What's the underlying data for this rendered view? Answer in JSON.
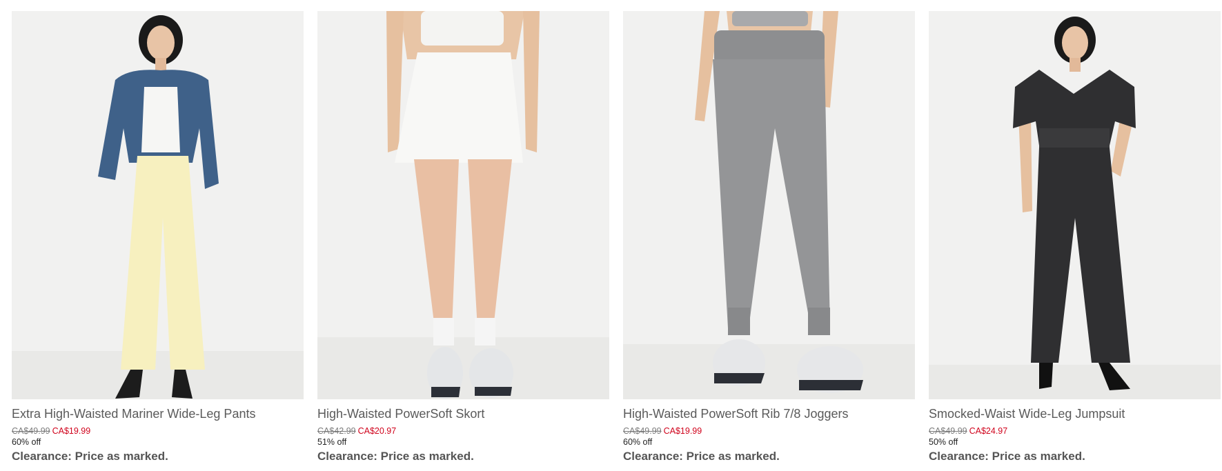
{
  "colors": {
    "sale_price": "#d0021b",
    "product_name": "#5a5a5a",
    "image_background": "#f1f1f0"
  },
  "products": [
    {
      "name": "Extra High-Waisted Mariner Wide-Leg Pants",
      "original_price": "CA$49.99",
      "sale_price": "CA$19.99",
      "discount": "60% off",
      "promo": "Clearance: Price as marked."
    },
    {
      "name": "High-Waisted PowerSoft Skort",
      "original_price": "CA$42.99",
      "sale_price": "CA$20.97",
      "discount": "51% off",
      "promo": "Clearance: Price as marked."
    },
    {
      "name": "High-Waisted PowerSoft Rib 7/8 Joggers",
      "original_price": "CA$49.99",
      "sale_price": "CA$19.99",
      "discount": "60% off",
      "promo": "Clearance: Price as marked."
    },
    {
      "name": "Smocked-Waist Wide-Leg Jumpsuit",
      "original_price": "CA$49.99",
      "sale_price": "CA$24.97",
      "discount": "50% off",
      "promo": "Clearance: Price as marked."
    }
  ]
}
